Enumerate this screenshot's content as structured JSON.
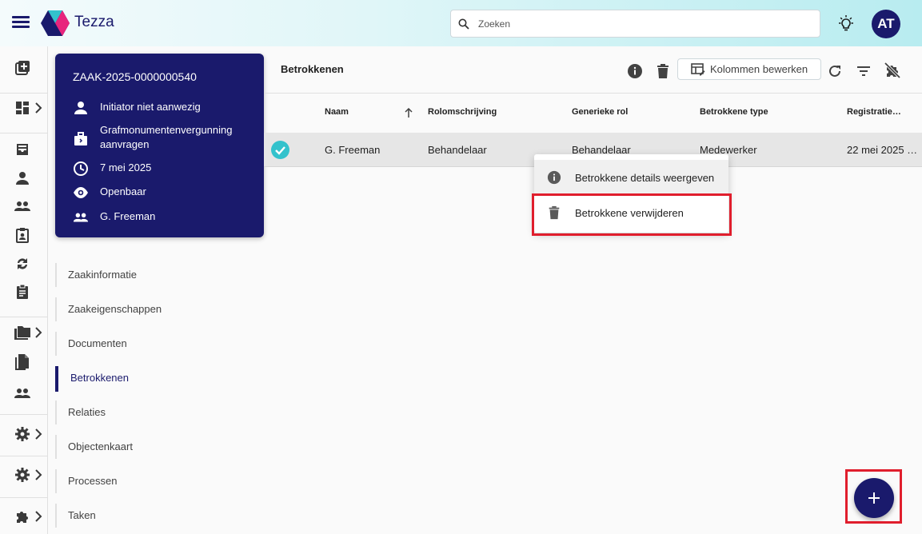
{
  "header": {
    "brand": "Tezza",
    "search_placeholder": "Zoeken",
    "avatar_initials": "AT",
    "accent_color": "#1a1a6c"
  },
  "rail": {
    "icons": [
      "add-box-icon",
      "dashboard-icon",
      "inbox-icon",
      "person-icon",
      "group-icon",
      "assignment-ind-icon",
      "sync-icon",
      "clipboard-icon",
      "folder-icon",
      "document-icon",
      "people-icon",
      "gear-icon",
      "gear-icon",
      "puzzle-icon"
    ]
  },
  "case_card": {
    "case_id": "ZAAK-2025-0000000540",
    "initiator": "Initiator niet aanwezig",
    "case_type": "Grafmonumentenvergunning aanvragen",
    "date": "7 mei 2025",
    "visibility": "Openbaar",
    "assignee": "G. Freeman"
  },
  "section_nav": {
    "items": [
      {
        "label": "Zaakinformatie",
        "active": false
      },
      {
        "label": "Zaakeigenschappen",
        "active": false
      },
      {
        "label": "Documenten",
        "active": false
      },
      {
        "label": "Betrokkenen",
        "active": true
      },
      {
        "label": "Relaties",
        "active": false
      },
      {
        "label": "Objectenkaart",
        "active": false
      },
      {
        "label": "Processen",
        "active": false
      },
      {
        "label": "Taken",
        "active": false
      }
    ]
  },
  "content": {
    "title": "Betrokkenen",
    "edit_columns_label": "Kolommen bewerken"
  },
  "table": {
    "columns": [
      "Naam",
      "Rolomschrijving",
      "Generieke rol",
      "Betrokkene type",
      "Registratie…"
    ],
    "rows": [
      {
        "naam": "G. Freeman",
        "rolomschrijving": "Behandelaar",
        "generieke_rol": "Behandelaar",
        "type": "Medewerker",
        "registratie": "22 mei 2025 …",
        "selected": true
      }
    ]
  },
  "context_menu": {
    "items": [
      {
        "label": "Betrokkene details weergeven",
        "icon": "info-icon"
      },
      {
        "label": "Betrokkene verwijderen",
        "icon": "trash-icon"
      }
    ]
  },
  "highlight_color": "#e01e2d"
}
